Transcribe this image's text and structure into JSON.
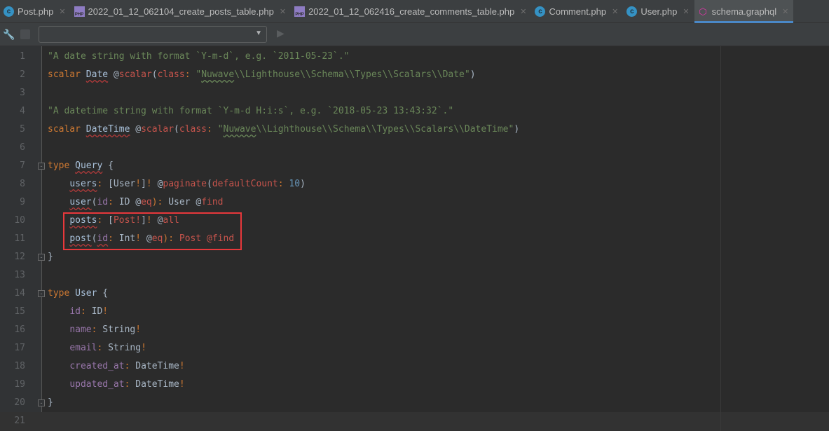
{
  "tabs": [
    {
      "label": "Post.php",
      "icon": "class-icon",
      "active": false
    },
    {
      "label": "2022_01_12_062104_create_posts_table.php",
      "icon": "php-file-icon",
      "active": false
    },
    {
      "label": "2022_01_12_062416_create_comments_table.php",
      "icon": "php-file-icon",
      "active": false
    },
    {
      "label": "Comment.php",
      "icon": "class-icon",
      "active": false
    },
    {
      "label": "User.php",
      "icon": "class-icon",
      "active": false
    },
    {
      "label": "schema.graphql",
      "icon": "graphql-icon",
      "active": true
    }
  ],
  "toolbar": {
    "combo_value": ""
  },
  "lines": [
    [
      [
        "\"A date string with format `Y-m-d`, e.g. `2011-05-23`.\"",
        "s"
      ]
    ],
    [
      [
        "scalar",
        "k"
      ],
      [
        " "
      ],
      [
        "Date",
        "t w"
      ],
      [
        " @"
      ],
      [
        "scalar",
        "d"
      ],
      [
        "("
      ],
      [
        "class",
        "d"
      ],
      [
        ": ",
        "p"
      ],
      [
        "\"",
        "s"
      ],
      [
        "Nuwave",
        "s g"
      ],
      [
        "\\\\Lighthouse\\\\Schema\\\\Types\\\\Scalars\\\\Date\"",
        "s"
      ],
      [
        ")"
      ]
    ],
    [],
    [
      [
        "\"A datetime string with format `Y-m-d H:i:s`, e.g. `2018-05-23 13:43:32`.\"",
        "s"
      ]
    ],
    [
      [
        "scalar",
        "k"
      ],
      [
        " "
      ],
      [
        "DateTime",
        "t w"
      ],
      [
        " @"
      ],
      [
        "scalar",
        "d"
      ],
      [
        "("
      ],
      [
        "class",
        "d"
      ],
      [
        ": ",
        "p"
      ],
      [
        "\"",
        "s"
      ],
      [
        "Nuwave",
        "s g"
      ],
      [
        "\\\\Lighthouse\\\\Schema\\\\Types\\\\Scalars\\\\DateTime\"",
        "s"
      ],
      [
        ")"
      ]
    ],
    [],
    [
      [
        "type",
        "k"
      ],
      [
        " "
      ],
      [
        "Query",
        "t w"
      ],
      [
        " {"
      ]
    ],
    [
      [
        "    "
      ],
      [
        "users",
        "t w"
      ],
      [
        ": ",
        "p"
      ],
      [
        "[User"
      ],
      [
        "!",
        "p"
      ],
      [
        "]"
      ],
      [
        "! ",
        "p"
      ],
      [
        "@"
      ],
      [
        "paginate",
        "d"
      ],
      [
        "("
      ],
      [
        "defaultCount",
        "d"
      ],
      [
        ": ",
        "p"
      ],
      [
        "10",
        "n"
      ],
      [
        ")"
      ]
    ],
    [
      [
        "    "
      ],
      [
        "user",
        "t w"
      ],
      [
        "("
      ],
      [
        "id",
        "f"
      ],
      [
        ": ",
        "p"
      ],
      [
        "ID @"
      ],
      [
        "eq",
        "d"
      ],
      [
        "): ",
        "p"
      ],
      [
        "User @"
      ],
      [
        "find",
        "d"
      ]
    ],
    [
      [
        "    "
      ],
      [
        "posts",
        "t w"
      ],
      [
        ": ",
        "p"
      ],
      [
        "["
      ],
      [
        "Post!",
        "d"
      ],
      [
        "]"
      ],
      [
        "! ",
        "p"
      ],
      [
        "@"
      ],
      [
        "all",
        "d"
      ]
    ],
    [
      [
        "    "
      ],
      [
        "post",
        "t w"
      ],
      [
        "("
      ],
      [
        "id",
        "f w"
      ],
      [
        ": ",
        "p"
      ],
      [
        "Int"
      ],
      [
        "! ",
        "p"
      ],
      [
        "@"
      ],
      [
        "eq",
        "d"
      ],
      [
        "): ",
        "p"
      ],
      [
        "Post @find",
        "d"
      ]
    ],
    [
      [
        "}"
      ]
    ],
    [],
    [
      [
        "type",
        "k"
      ],
      [
        " "
      ],
      [
        "User",
        "t"
      ],
      [
        " {"
      ]
    ],
    [
      [
        "    "
      ],
      [
        "id",
        "f"
      ],
      [
        ": ",
        "p"
      ],
      [
        "ID"
      ],
      [
        "!",
        "p"
      ]
    ],
    [
      [
        "    "
      ],
      [
        "name",
        "f"
      ],
      [
        ": ",
        "p"
      ],
      [
        "String"
      ],
      [
        "!",
        "p"
      ]
    ],
    [
      [
        "    "
      ],
      [
        "email",
        "f"
      ],
      [
        ": ",
        "p"
      ],
      [
        "String"
      ],
      [
        "!",
        "p"
      ]
    ],
    [
      [
        "    "
      ],
      [
        "created_at",
        "f"
      ],
      [
        ": ",
        "p"
      ],
      [
        "DateTime"
      ],
      [
        "!",
        "p"
      ]
    ],
    [
      [
        "    "
      ],
      [
        "updated_at",
        "f"
      ],
      [
        ": ",
        "p"
      ],
      [
        "DateTime"
      ],
      [
        "!",
        "p"
      ]
    ],
    [
      [
        "}"
      ]
    ],
    []
  ]
}
